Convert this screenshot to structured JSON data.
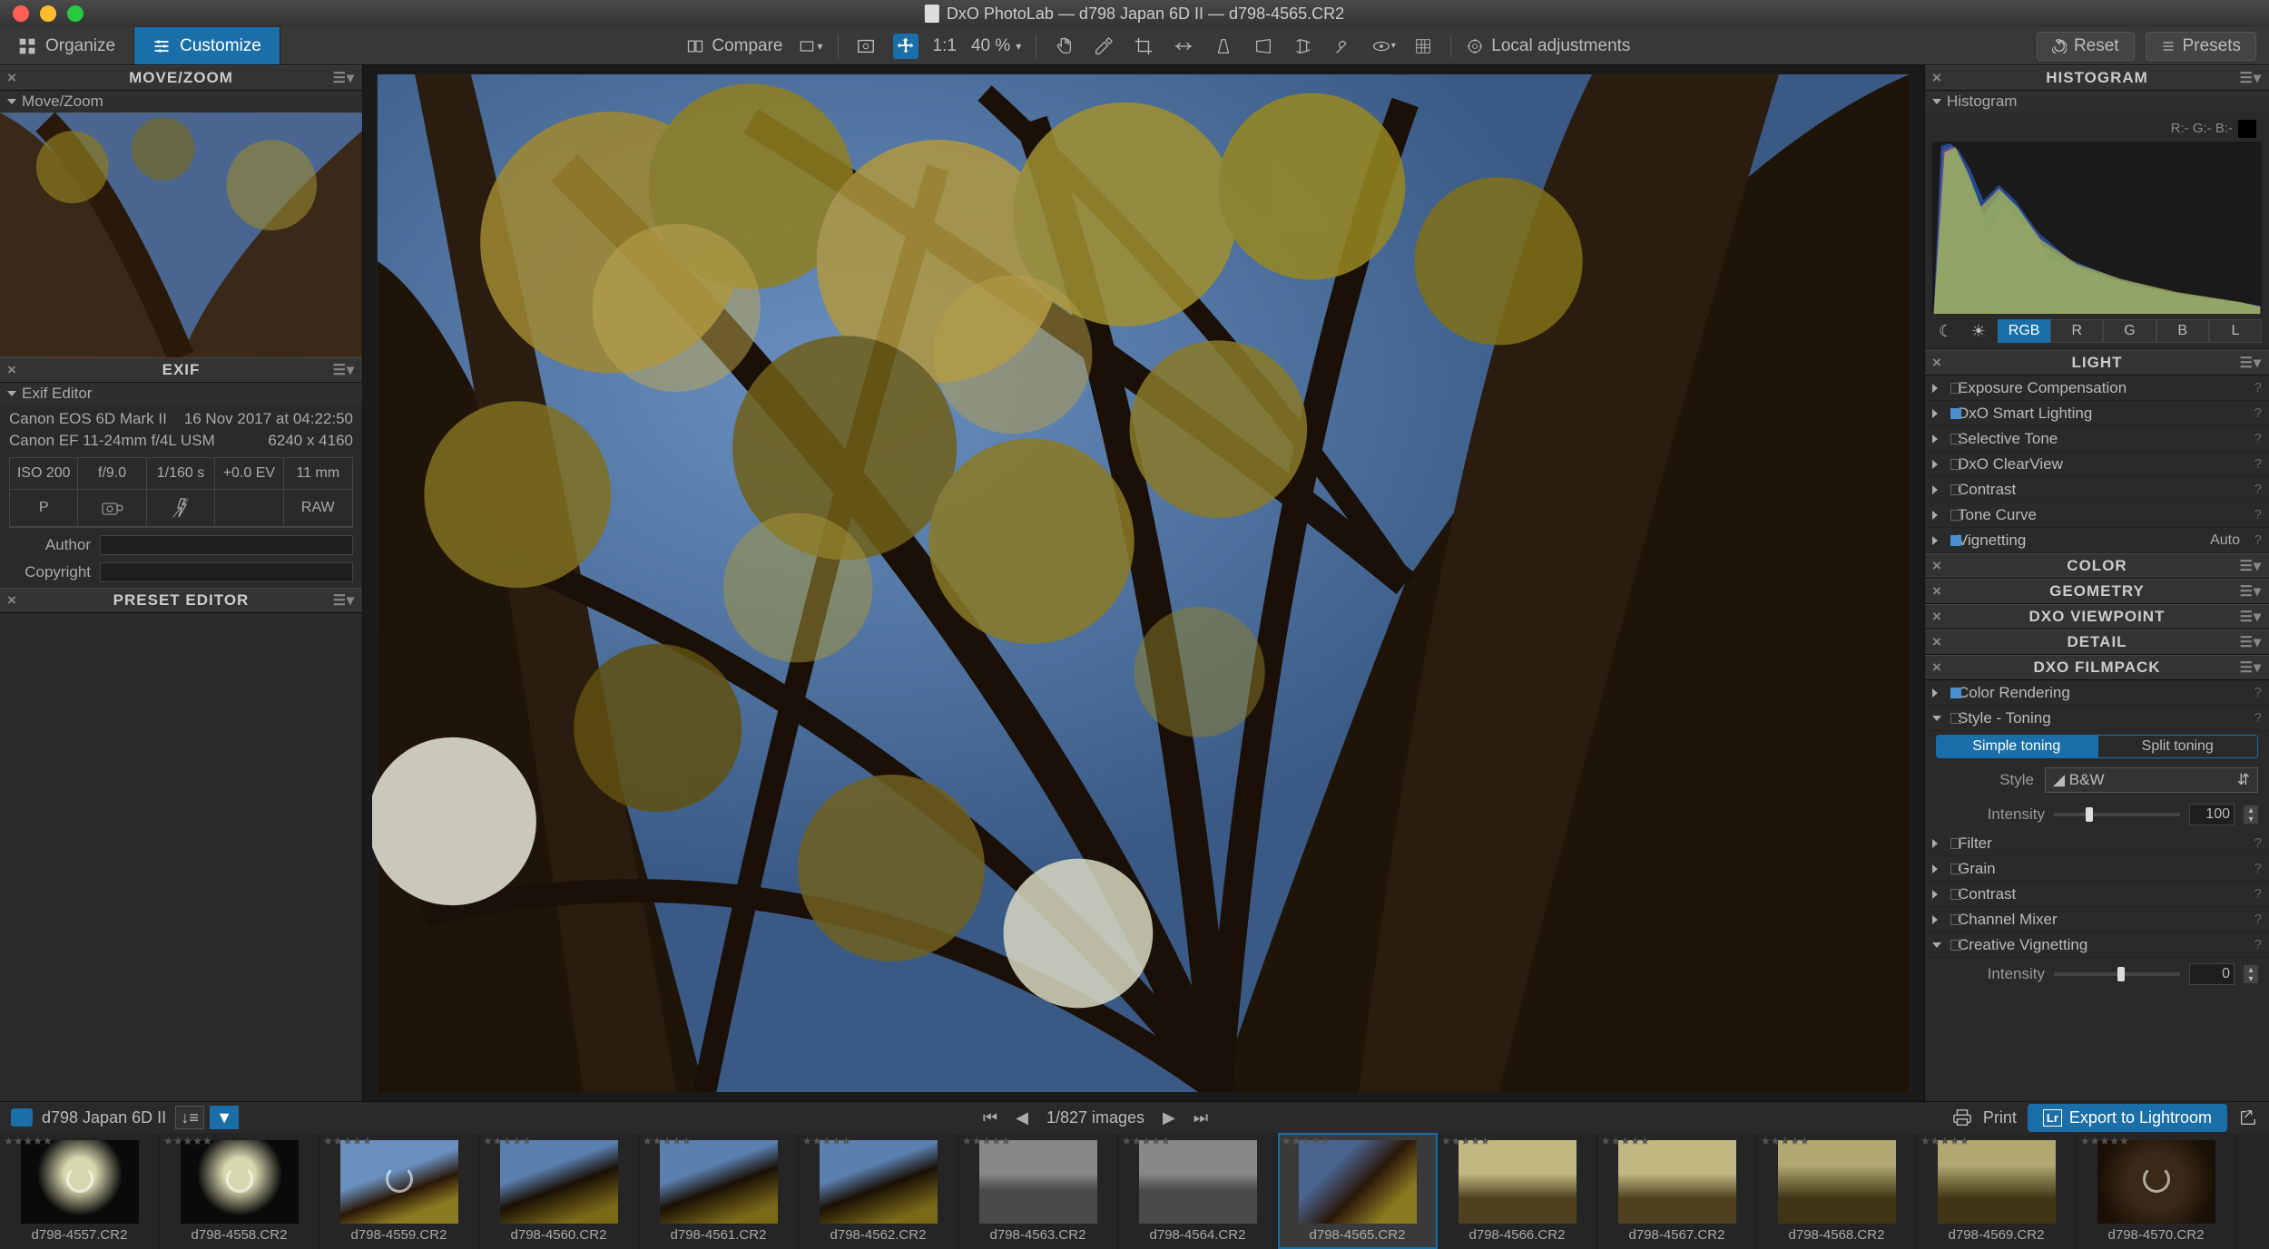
{
  "titlebar": {
    "title": "DxO PhotoLab — d798 Japan 6D II — d798-4565.CR2"
  },
  "toolbar": {
    "organize": "Organize",
    "customize": "Customize",
    "compare": "Compare",
    "zoom_label": "1:1",
    "zoom_value": "40 %",
    "local_adjustments": "Local adjustments",
    "reset": "Reset",
    "presets": "Presets"
  },
  "left": {
    "movezoom": {
      "header": "MOVE/ZOOM",
      "sub": "Move/Zoom"
    },
    "exif": {
      "header": "EXIF",
      "sub": "Exif Editor",
      "camera": "Canon EOS 6D Mark II",
      "date": "16 Nov 2017 at 04:22:50",
      "lens": "Canon EF 11-24mm f/4L USM",
      "dimensions": "6240 x 4160",
      "cells": [
        "ISO 200",
        "f/9.0",
        "1/160 s",
        "+0.0 EV",
        "11 mm",
        "P",
        "",
        "",
        "",
        "RAW"
      ],
      "author_label": "Author",
      "copyright_label": "Copyright"
    },
    "preset_editor": {
      "header": "PRESET EDITOR"
    }
  },
  "right": {
    "histogram": {
      "header": "HISTOGRAM",
      "sub": "Histogram",
      "rgb_label": "R:- G:- B:-",
      "channels": [
        "RGB",
        "R",
        "G",
        "B",
        "L"
      ],
      "active": "RGB"
    },
    "sections": {
      "light": {
        "header": "LIGHT",
        "items": [
          {
            "label": "Exposure Compensation",
            "on": false,
            "expanded": false
          },
          {
            "label": "DxO Smart Lighting",
            "on": true,
            "expanded": false
          },
          {
            "label": "Selective Tone",
            "on": false,
            "expanded": false
          },
          {
            "label": "DxO ClearView",
            "on": false,
            "expanded": false
          },
          {
            "label": "Contrast",
            "on": false,
            "expanded": false
          },
          {
            "label": "Tone Curve",
            "on": false,
            "expanded": false
          },
          {
            "label": "Vignetting",
            "on": true,
            "expanded": false,
            "auto": "Auto"
          }
        ]
      },
      "color": {
        "header": "COLOR"
      },
      "geometry": {
        "header": "GEOMETRY"
      },
      "viewpoint": {
        "header": "DXO VIEWPOINT"
      },
      "detail": {
        "header": "DETAIL"
      },
      "filmpack": {
        "header": "DXO FILMPACK",
        "items": [
          {
            "label": "Color Rendering",
            "on": true,
            "expanded": false
          },
          {
            "label": "Style - Toning",
            "on": false,
            "expanded": true,
            "toning": {
              "tabs": [
                "Simple toning",
                "Split toning"
              ],
              "active": "Simple toning",
              "style_label": "Style",
              "style_value": "B&W",
              "intensity_label": "Intensity",
              "intensity_value": "100"
            }
          },
          {
            "label": "Filter",
            "on": false,
            "expanded": false
          },
          {
            "label": "Grain",
            "on": false,
            "expanded": false
          },
          {
            "label": "Contrast",
            "on": false,
            "expanded": false
          },
          {
            "label": "Channel Mixer",
            "on": false,
            "expanded": false
          },
          {
            "label": "Creative Vignetting",
            "on": false,
            "expanded": true,
            "intensity_label": "Intensity",
            "intensity_value": "0"
          }
        ]
      }
    }
  },
  "bottom": {
    "folder": "d798 Japan 6D II",
    "counter": "1/827 images",
    "print": "Print",
    "export_lr": "Export to Lightroom",
    "thumbs": [
      "d798-4557.CR2",
      "d798-4558.CR2",
      "d798-4559.CR2",
      "d798-4560.CR2",
      "d798-4561.CR2",
      "d798-4562.CR2",
      "d798-4563.CR2",
      "d798-4564.CR2",
      "d798-4565.CR2",
      "d798-4566.CR2",
      "d798-4567.CR2",
      "d798-4568.CR2",
      "d798-4569.CR2",
      "d798-4570.CR2"
    ],
    "selected_index": 8
  }
}
